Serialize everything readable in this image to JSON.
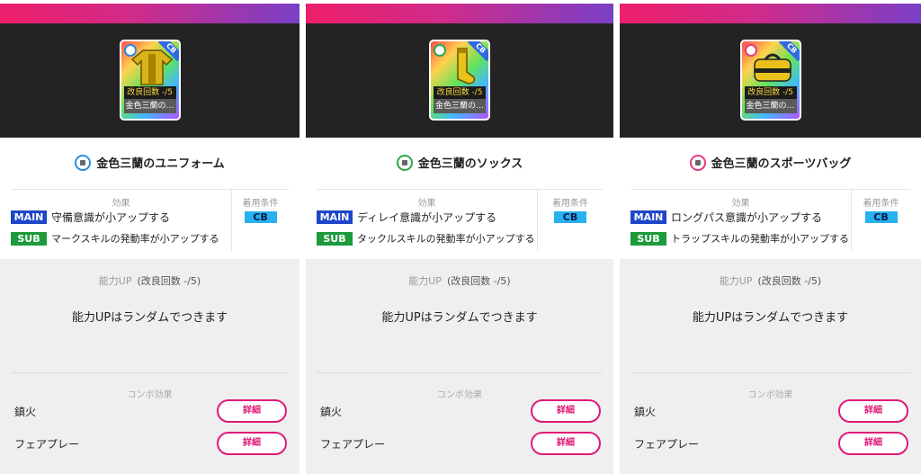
{
  "panels": [
    {
      "card": {
        "count": "改良回数 -/5",
        "name": "金色三蘭の…",
        "position": "CB",
        "icon": "uniform-shirt-icon"
      },
      "title": "金色三蘭のユニフォーム",
      "effects_heading": "効果",
      "main_tag": "MAIN",
      "main_text": "守備意識が小アップする",
      "sub_tag": "SUB",
      "sub_text": "マークスキルの発動率が小アップする",
      "req_heading": "着用条件",
      "req_badge": "CB",
      "ability_heading": "能力UP",
      "ability_count": "(改良回数 -/5)",
      "ability_text": "能力UPはランダムでつきます",
      "combo_heading": "コンボ効果",
      "combos": [
        {
          "label": "鎮火",
          "button": "詳細"
        },
        {
          "label": "フェアプレー",
          "button": "詳細"
        }
      ]
    },
    {
      "card": {
        "count": "改良回数 -/5",
        "name": "金色三蘭の…",
        "position": "CB",
        "icon": "socks-icon"
      },
      "title": "金色三蘭のソックス",
      "effects_heading": "効果",
      "main_tag": "MAIN",
      "main_text": "ディレイ意識が小アップする",
      "sub_tag": "SUB",
      "sub_text": "タックルスキルの発動率が小アップする",
      "req_heading": "着用条件",
      "req_badge": "CB",
      "ability_heading": "能力UP",
      "ability_count": "(改良回数 -/5)",
      "ability_text": "能力UPはランダムでつきます",
      "combo_heading": "コンボ効果",
      "combos": [
        {
          "label": "鎮火",
          "button": "詳細"
        },
        {
          "label": "フェアプレー",
          "button": "詳細"
        }
      ]
    },
    {
      "card": {
        "count": "改良回数 -/5",
        "name": "金色三蘭の…",
        "position": "CB",
        "icon": "sports-bag-icon"
      },
      "title": "金色三蘭のスポーツバッグ",
      "effects_heading": "効果",
      "main_tag": "MAIN",
      "main_text": "ロングパス意識が小アップする",
      "sub_tag": "SUB",
      "sub_text": "トラップスキルの発動率が小アップする",
      "req_heading": "着用条件",
      "req_badge": "CB",
      "ability_heading": "能力UP",
      "ability_count": "(改良回数 -/5)",
      "ability_text": "能力UPはランダムでつきます",
      "combo_heading": "コンボ効果",
      "combos": [
        {
          "label": "鎮火",
          "button": "詳細"
        },
        {
          "label": "フェアプレー",
          "button": "詳細"
        }
      ]
    }
  ],
  "colors": {
    "stripe_start": "#ee1f6a",
    "stripe_end": "#7a3fc7",
    "main_tag": "#1d46c8",
    "sub_tag": "#1d9a3b",
    "req_badge": "#27b1ee",
    "detail_button": "#e0197a"
  }
}
